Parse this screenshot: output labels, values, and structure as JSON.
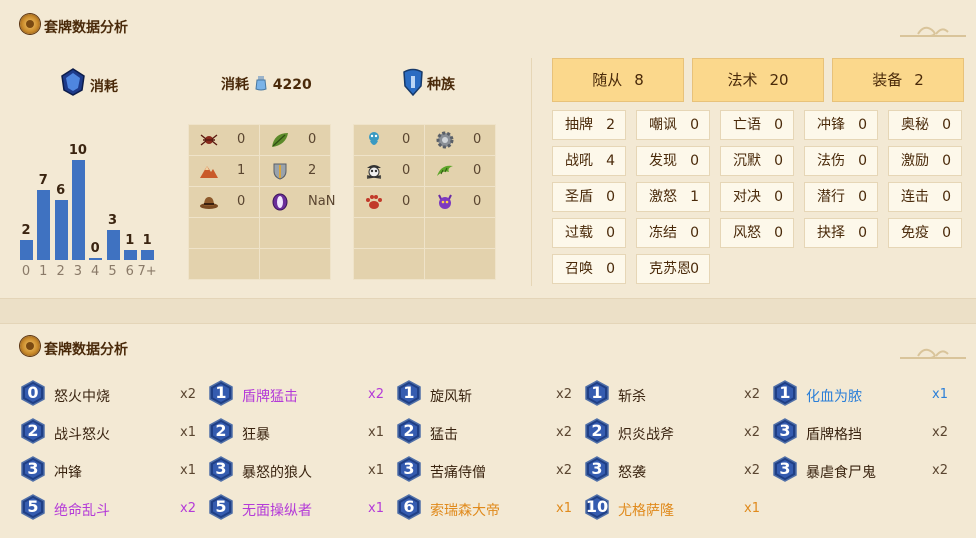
{
  "colors": {
    "rare": "#2b7fd8",
    "epic": "#b43ad8",
    "legendary": "#e08a1c",
    "common": "#3a2410",
    "bar": "#3f72c1"
  },
  "section1": {
    "title": "套牌数据分析"
  },
  "section2": {
    "title": "套牌数据分析"
  },
  "stats": {
    "cost_label": "消耗",
    "dust_label": "消耗",
    "dust_value": "4220",
    "race_label": "种族"
  },
  "chart_data": {
    "type": "bar",
    "categories": [
      "0",
      "1",
      "2",
      "3",
      "4",
      "5",
      "6",
      "7+"
    ],
    "values": [
      2,
      7,
      6,
      10,
      0,
      3,
      1,
      1
    ],
    "title": "",
    "xlabel": "",
    "ylabel": ""
  },
  "types_grid": [
    [
      {
        "icon": "spider-icon",
        "value": "0"
      },
      {
        "icon": "leaf-icon",
        "value": "0"
      }
    ],
    [
      {
        "icon": "mountain-icon",
        "value": "1"
      },
      {
        "icon": "shield-icon",
        "value": "2"
      }
    ],
    [
      {
        "icon": "hat-icon",
        "value": "0"
      },
      {
        "icon": "purple-orb-icon",
        "value": "NaN"
      }
    ],
    [
      {
        "icon": "",
        "value": ""
      },
      {
        "icon": "",
        "value": ""
      }
    ],
    [
      {
        "icon": "",
        "value": ""
      },
      {
        "icon": "",
        "value": ""
      }
    ]
  ],
  "races_grid": [
    [
      {
        "icon": "murloc-icon",
        "value": "0"
      },
      {
        "icon": "gear-icon",
        "value": "0"
      }
    ],
    [
      {
        "icon": "pirate-icon",
        "value": "0"
      },
      {
        "icon": "dragon-icon",
        "value": "0"
      }
    ],
    [
      {
        "icon": "beast-paw-icon",
        "value": "0"
      },
      {
        "icon": "demon-icon",
        "value": "0"
      }
    ],
    [
      {
        "icon": "",
        "value": ""
      },
      {
        "icon": "",
        "value": ""
      }
    ],
    [
      {
        "icon": "",
        "value": ""
      },
      {
        "icon": "",
        "value": ""
      }
    ]
  ],
  "card_types": [
    {
      "label": "随从",
      "value": "8"
    },
    {
      "label": "法术",
      "value": "20"
    },
    {
      "label": "装备",
      "value": "2"
    }
  ],
  "mechanics": [
    {
      "label": "抽牌",
      "value": "2"
    },
    {
      "label": "嘲讽",
      "value": "0"
    },
    {
      "label": "亡语",
      "value": "0"
    },
    {
      "label": "冲锋",
      "value": "0"
    },
    {
      "label": "奥秘",
      "value": "0"
    },
    {
      "label": "战吼",
      "value": "4"
    },
    {
      "label": "发现",
      "value": "0"
    },
    {
      "label": "沉默",
      "value": "0"
    },
    {
      "label": "法伤",
      "value": "0"
    },
    {
      "label": "激励",
      "value": "0"
    },
    {
      "label": "圣盾",
      "value": "0"
    },
    {
      "label": "激怒",
      "value": "1"
    },
    {
      "label": "对决",
      "value": "0"
    },
    {
      "label": "潜行",
      "value": "0"
    },
    {
      "label": "连击",
      "value": "0"
    },
    {
      "label": "过载",
      "value": "0"
    },
    {
      "label": "冻结",
      "value": "0"
    },
    {
      "label": "风怒",
      "value": "0"
    },
    {
      "label": "抉择",
      "value": "0"
    },
    {
      "label": "免疫",
      "value": "0"
    },
    {
      "label": "召唤",
      "value": "0"
    },
    {
      "label": "克苏恩",
      "value": "0"
    }
  ],
  "cards": [
    [
      {
        "cost": "0",
        "name": "怒火中烧",
        "count": "x2",
        "rarity": "common"
      },
      {
        "cost": "2",
        "name": "战斗怒火",
        "count": "x1",
        "rarity": "common"
      },
      {
        "cost": "3",
        "name": "冲锋",
        "count": "x1",
        "rarity": "common"
      },
      {
        "cost": "5",
        "name": "绝命乱斗",
        "count": "x2",
        "rarity": "epic"
      }
    ],
    [
      {
        "cost": "1",
        "name": "盾牌猛击",
        "count": "x2",
        "rarity": "epic"
      },
      {
        "cost": "2",
        "name": "狂暴",
        "count": "x1",
        "rarity": "common"
      },
      {
        "cost": "3",
        "name": "暴怒的狼人",
        "count": "x1",
        "rarity": "common"
      },
      {
        "cost": "5",
        "name": "无面操纵者",
        "count": "x1",
        "rarity": "epic"
      }
    ],
    [
      {
        "cost": "1",
        "name": "旋风斩",
        "count": "x2",
        "rarity": "common"
      },
      {
        "cost": "2",
        "name": "猛击",
        "count": "x2",
        "rarity": "common"
      },
      {
        "cost": "3",
        "name": "苦痛侍僧",
        "count": "x2",
        "rarity": "common"
      },
      {
        "cost": "6",
        "name": "索瑞森大帝",
        "count": "x1",
        "rarity": "legendary"
      }
    ],
    [
      {
        "cost": "1",
        "name": "斩杀",
        "count": "x2",
        "rarity": "common"
      },
      {
        "cost": "2",
        "name": "炽炎战斧",
        "count": "x2",
        "rarity": "common"
      },
      {
        "cost": "3",
        "name": "怒袭",
        "count": "x2",
        "rarity": "common"
      },
      {
        "cost": "10",
        "name": "尤格萨隆",
        "count": "x1",
        "rarity": "legendary"
      }
    ],
    [
      {
        "cost": "1",
        "name": "化血为脓",
        "count": "x1",
        "rarity": "rare"
      },
      {
        "cost": "3",
        "name": "盾牌格挡",
        "count": "x2",
        "rarity": "common"
      },
      {
        "cost": "3",
        "name": "暴虐食尸鬼",
        "count": "x2",
        "rarity": "common"
      }
    ]
  ]
}
